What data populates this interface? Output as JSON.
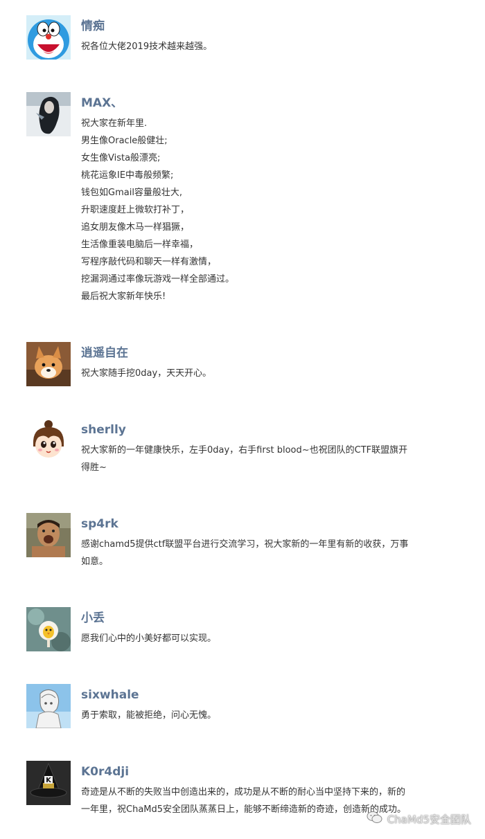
{
  "comments": [
    {
      "username": "情痴",
      "avatar": "doraemon-face",
      "lines": [
        "祝各位大佬2019技术越来越强。"
      ]
    },
    {
      "username": "MAX、",
      "avatar": "dark-haired-figure",
      "lines": [
        "祝大家在新年里.",
        "男生像Oracle般健壮;",
        "女生像Vista般漂亮;",
        "桃花运象IE中毒般频繁;",
        "钱包如Gmail容量般壮大,",
        "升职速度赶上微软打补丁，",
        "追女朋友像木马一样猖獗，",
        "生活像重装电脑后一样幸福，",
        "写程序敲代码和聊天一样有激情，",
        "挖漏洞通过率像玩游戏一样全部通过。",
        "最后祝大家新年快乐!"
      ]
    },
    {
      "username": "逍遥自在",
      "avatar": "corgi-puppy",
      "lines": [
        "祝大家随手挖0day，天天开心。"
      ]
    },
    {
      "username": "sherlly",
      "avatar": "cartoon-girl",
      "lines": [
        "祝大家新的一年健康快乐，左手0day，右手first blood~也祝团队的CTF联盟旗开",
        "得胜~"
      ]
    },
    {
      "username": "sp4rk",
      "avatar": "shouting-man",
      "lines": [
        "感谢chamd5提供ctf联盟平台进行交流学习，祝大家新的一年里有新的收获，万事",
        "如意。"
      ]
    },
    {
      "username": "小丢",
      "avatar": "yellow-chick",
      "lines": [
        "愿我们心中的小美好都可以实现。"
      ]
    },
    {
      "username": "sixwhale",
      "avatar": "anime-sketch",
      "lines": [
        "勇于索取，能被拒绝，问心无愧。"
      ]
    },
    {
      "username": "K0r4dji",
      "avatar": "witch-hat-k",
      "lines": [
        "奇迹是从不断的失败当中创造出来的，成功是从不断的耐心当中坚持下来的，新的",
        "一年里，祝ChaMd5安全团队蒸蒸日上，能够不断缔造新的奇迹，创造新的成功。"
      ]
    }
  ],
  "watermark": {
    "text": "ChaMd5安全团队",
    "icon": "wechat-icon"
  }
}
